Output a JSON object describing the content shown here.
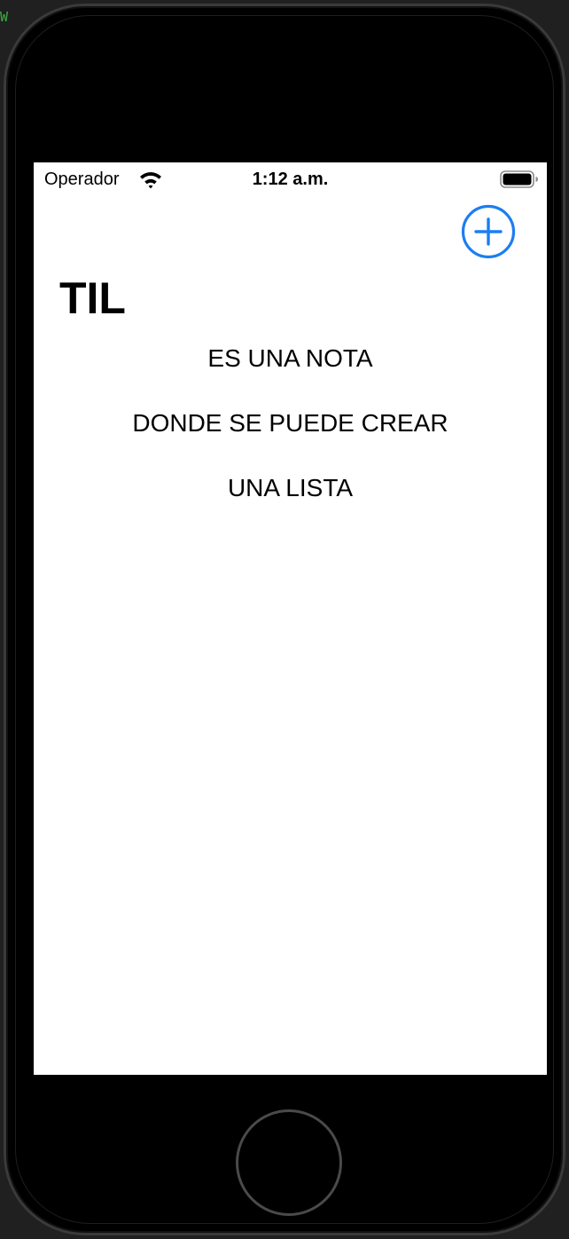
{
  "status_bar": {
    "carrier": "Operador",
    "time": "1:12 a.m.",
    "wifi_icon": "wifi-icon",
    "battery_icon": "battery-full-icon"
  },
  "nav": {
    "add_icon": "plus-circle-icon",
    "accent_color": "#1c7ef0"
  },
  "title": "TIL",
  "notes": [
    {
      "text": "ES UNA NOTA"
    },
    {
      "text": "DONDE SE PUEDE CREAR"
    },
    {
      "text": "UNA LISTA"
    }
  ],
  "edge_glyph": "W",
  "device": {
    "home_button_icon": "home-button-icon"
  }
}
